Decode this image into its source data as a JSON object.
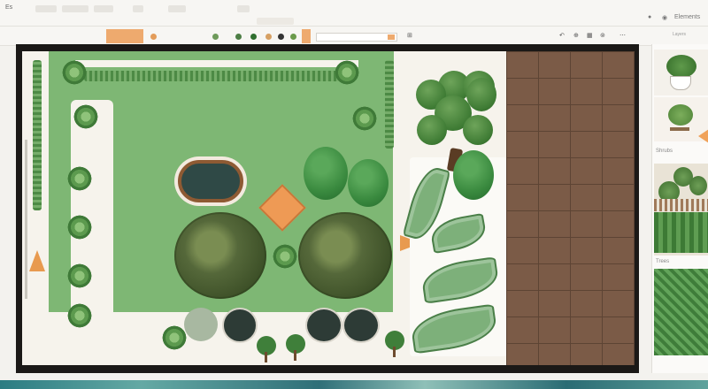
{
  "app": {
    "name": "Es"
  },
  "topbar": {
    "right_icons": [
      "settings-icon",
      "user-icon"
    ],
    "right_label": "Elements"
  },
  "toolbar": {
    "left_text": "",
    "right_label": "Layers"
  },
  "panel": {
    "thumb_labels": [
      "Shrubs",
      "Trees"
    ]
  },
  "colors": {
    "lawn": "#7eb774",
    "deck": "#7b5b47",
    "accent": "#eeaa6e"
  }
}
